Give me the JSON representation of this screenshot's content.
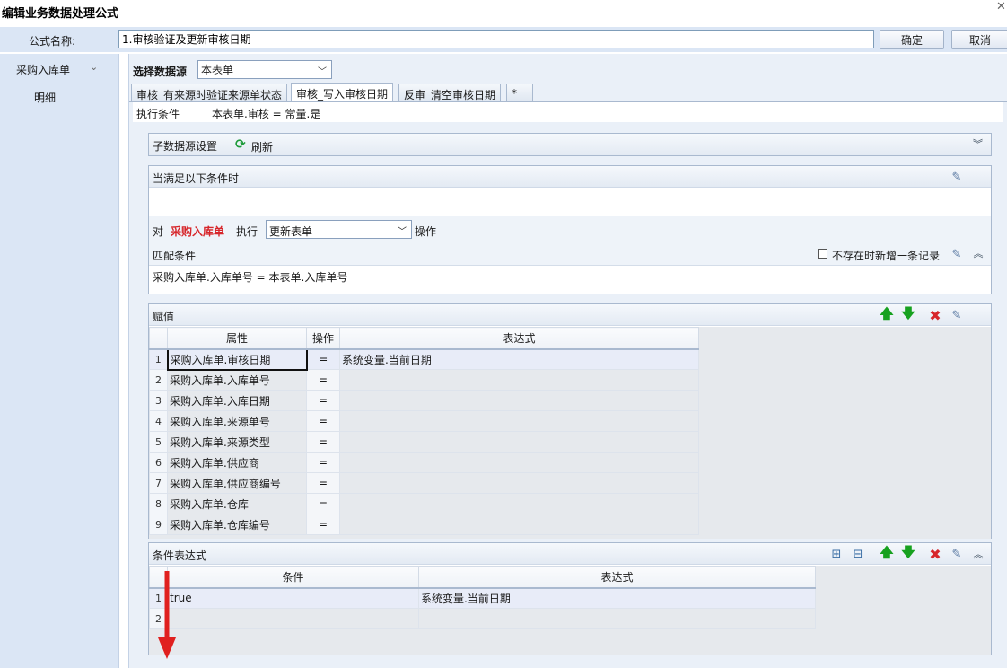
{
  "window": {
    "title": "编辑业务数据处理公式",
    "close_glyph": "✕"
  },
  "formula": {
    "name_label": "公式名称:",
    "name_value": "1.审核验证及更新审核日期",
    "ok_label": "确定",
    "cancel_label": "取消"
  },
  "sidebar": {
    "header": "采购入库单",
    "items": [
      {
        "label": "明细"
      }
    ]
  },
  "datasource": {
    "label": "选择数据源",
    "selected": "本表单"
  },
  "tabs": [
    {
      "label": "审核_有来源时验证来源单状态",
      "active": false
    },
    {
      "label": "审核_写入审核日期",
      "active": true
    },
    {
      "label": "反审_清空审核日期",
      "active": false
    },
    {
      "label": "*",
      "active": false
    }
  ],
  "exec_condition": {
    "label": "执行条件",
    "value": "本表单.审核 = 常量.是"
  },
  "sub_source": {
    "title": "子数据源设置",
    "refresh_label": "刷新"
  },
  "condition": {
    "title": "当满足以下条件时",
    "prefix": "对",
    "target": "采购入库单",
    "exec_word": "执行",
    "action_selected": "更新表单",
    "suffix": "操作",
    "match_title": "匹配条件",
    "new_record_label": "不存在时新增一条记录",
    "match_expression": "采购入库单.入库单号 = 本表单.入库单号"
  },
  "assign": {
    "title": "赋值",
    "columns": [
      "属性",
      "操作",
      "表达式"
    ],
    "rows": [
      {
        "n": "1",
        "attr": "采购入库单.审核日期",
        "op": "=",
        "expr": "系统变量.当前日期"
      },
      {
        "n": "2",
        "attr": "采购入库单.入库单号",
        "op": "=",
        "expr": ""
      },
      {
        "n": "3",
        "attr": "采购入库单.入库日期",
        "op": "=",
        "expr": ""
      },
      {
        "n": "4",
        "attr": "采购入库单.来源单号",
        "op": "=",
        "expr": ""
      },
      {
        "n": "5",
        "attr": "采购入库单.来源类型",
        "op": "=",
        "expr": ""
      },
      {
        "n": "6",
        "attr": "采购入库单.供应商",
        "op": "=",
        "expr": ""
      },
      {
        "n": "7",
        "attr": "采购入库单.供应商编号",
        "op": "=",
        "expr": ""
      },
      {
        "n": "8",
        "attr": "采购入库单.仓库",
        "op": "=",
        "expr": ""
      },
      {
        "n": "9",
        "attr": "采购入库单.仓库编号",
        "op": "=",
        "expr": ""
      }
    ]
  },
  "cond_expr": {
    "title": "条件表达式",
    "columns": [
      "条件",
      "表达式"
    ],
    "rows": [
      {
        "n": "1",
        "cond": "true",
        "expr": "系统变量.当前日期"
      },
      {
        "n": "2",
        "cond": "",
        "expr": ""
      }
    ]
  },
  "colors": {
    "accent_red": "#d7262b",
    "arrow_green": "#17a11f",
    "panel_blue": "#dbe6f5"
  }
}
